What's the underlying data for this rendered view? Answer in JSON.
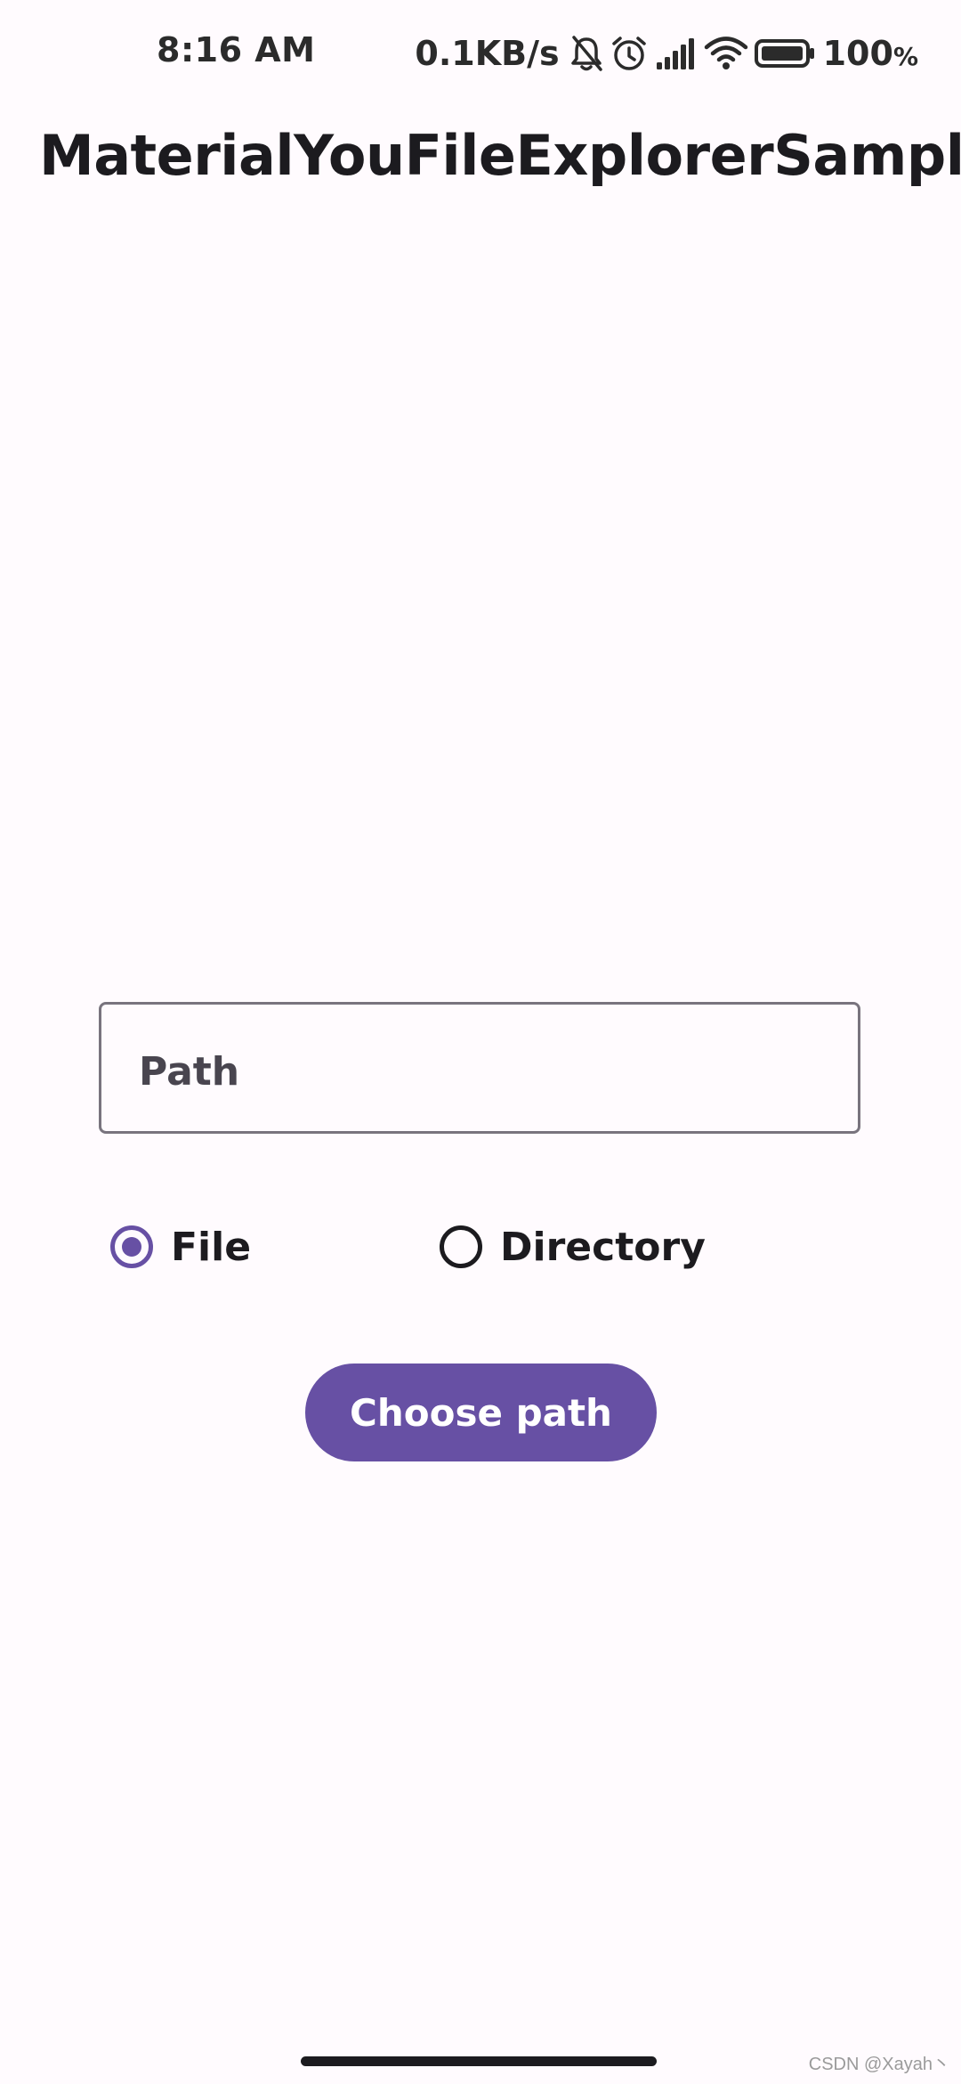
{
  "status_bar": {
    "time": "8:16 AM",
    "network_speed": "0.1KB/s",
    "icons": [
      "bell-off-icon",
      "alarm-icon",
      "signal-icon",
      "wifi-icon",
      "battery-icon"
    ],
    "battery_level": "100",
    "battery_unit": "%"
  },
  "app_bar": {
    "title": "MaterialYouFileExplorerSample"
  },
  "form": {
    "path_field": {
      "placeholder": "Path",
      "value": ""
    },
    "radio_options": [
      {
        "label": "File",
        "selected": true
      },
      {
        "label": "Directory",
        "selected": false
      }
    ],
    "button_label": "Choose path"
  },
  "colors": {
    "primary": "#6750A4",
    "background": "#FFFBFE",
    "outline": "#79747E",
    "on_surface": "#1C1B1F"
  },
  "watermark": "CSDN @Xayah丶"
}
